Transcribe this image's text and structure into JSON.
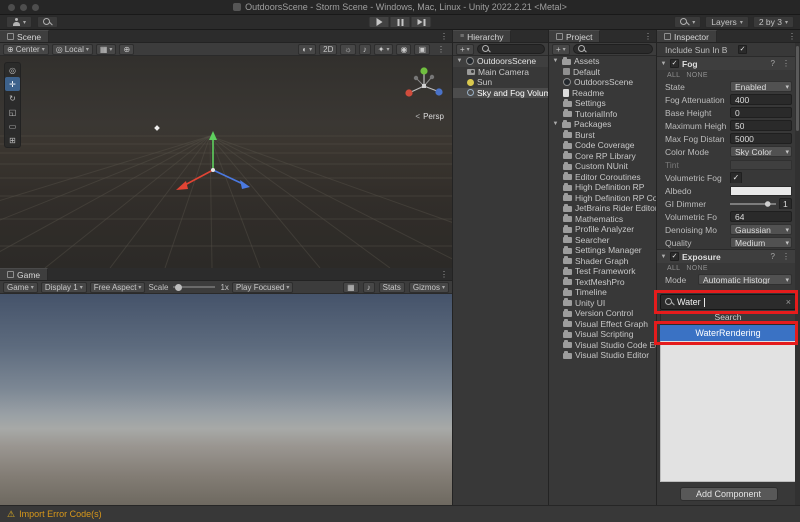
{
  "window": {
    "title": "OutdoorsScene - Storm Scene - Windows, Mac, Linux - Unity 2022.2.21 <Metal>"
  },
  "icons": {
    "kebab": "⋮",
    "foldout_open": "▼",
    "check": "✓",
    "plus": "+",
    "close": "×",
    "help": "?",
    "warning": "⚠",
    "hamburger": "≡",
    "dropdown": "▾",
    "tool_view": "◎",
    "tool_move": "✛",
    "tool_rotate": "↻",
    "tool_scale": "◱",
    "tool_rect": "▭",
    "tool_transform": "⊞",
    "pivot": "⊕",
    "orientation": "◎",
    "grid": "▦",
    "snap": "⊕",
    "shading": "◐",
    "lighting": "☼",
    "audio": "♪",
    "effects": "✦",
    "visibility": "◉",
    "camera": "▣"
  },
  "topbar": {
    "layers": "Layers",
    "layout": "2 by 3"
  },
  "scene": {
    "tab": "Scene",
    "pivot": "Center",
    "orientation": "Local",
    "mode_2d": "2D",
    "persp_arrow": "<",
    "persp": "Persp"
  },
  "game": {
    "tab": "Game",
    "menu": "Game",
    "display": "Display 1",
    "aspect": "Free Aspect",
    "scale_label": "Scale",
    "scale_value": "1x",
    "play_focused": "Play Focused",
    "stats": "Stats",
    "gizmos": "Gizmos"
  },
  "hierarchy": {
    "tab": "Hierarchy",
    "root": "OutdoorsScene",
    "items": [
      {
        "name": "Main Camera",
        "icon": "camera"
      },
      {
        "name": "Sun",
        "icon": "light"
      },
      {
        "name": "Sky and Fog Volume",
        "icon": "volume",
        "state": "selected"
      }
    ]
  },
  "project": {
    "tab": "Project",
    "assets_root": "Assets",
    "assets": [
      {
        "name": "Default",
        "icon": "cube"
      },
      {
        "name": "OutdoorsScene",
        "icon": "scene"
      },
      {
        "name": "Readme",
        "icon": "doc"
      },
      {
        "name": "Settings",
        "icon": "folder"
      },
      {
        "name": "TutorialInfo",
        "icon": "folder"
      }
    ],
    "packages_root": "Packages",
    "packages": [
      "Burst",
      "Code Coverage",
      "Core RP Library",
      "Custom NUnit",
      "Editor Coroutines",
      "High Definition RP",
      "High Definition RP Co",
      "JetBrains Rider Editor",
      "Mathematics",
      "Profile Analyzer",
      "Searcher",
      "Settings Manager",
      "Shader Graph",
      "Test Framework",
      "TextMeshPro",
      "Timeline",
      "Unity UI",
      "Version Control",
      "Visual Effect Graph",
      "Visual Scripting",
      "Visual Studio Code Ed",
      "Visual Studio Editor"
    ]
  },
  "inspector": {
    "tab": "Inspector",
    "include_sun_label": "Include Sun In B",
    "all_label": "ALL",
    "none_label": "NONE",
    "fog": {
      "title": "Fog",
      "rows": [
        {
          "label": "State",
          "value": "Enabled",
          "type": "dropdown"
        },
        {
          "label": "Fog Attenuation",
          "value": "400",
          "type": "field"
        },
        {
          "label": "Base Height",
          "value": "0",
          "type": "field"
        },
        {
          "label": "Maximum Heigh",
          "value": "50",
          "type": "field"
        },
        {
          "label": "Max Fog Distan",
          "value": "5000",
          "type": "field"
        },
        {
          "label": "Color Mode",
          "value": "Sky Color",
          "type": "dropdown"
        },
        {
          "label": "Tint",
          "value": "",
          "type": "color",
          "state": "dim"
        },
        {
          "label": "Volumetric Fog",
          "value": "",
          "type": "checkbox"
        },
        {
          "label": "Albedo",
          "value": "",
          "type": "swatch"
        },
        {
          "label": "GI Dimmer",
          "value": "1",
          "type": "slider"
        },
        {
          "label": "Volumetric Fo",
          "value": "64",
          "type": "field"
        },
        {
          "label": "Denoising Mo",
          "value": "Gaussian",
          "type": "dropdown"
        },
        {
          "label": "Quality",
          "value": "Medium",
          "type": "dropdown"
        }
      ]
    },
    "exposure": {
      "title": "Exposure",
      "mode_label": "Mode",
      "mode_value": "Automatic Histogr"
    },
    "search_popup": {
      "query": "Water",
      "header": "Search",
      "result": "WaterRendering"
    },
    "add_component": "Add Component"
  },
  "statusbar": {
    "message": "Import Error Code(s)"
  }
}
